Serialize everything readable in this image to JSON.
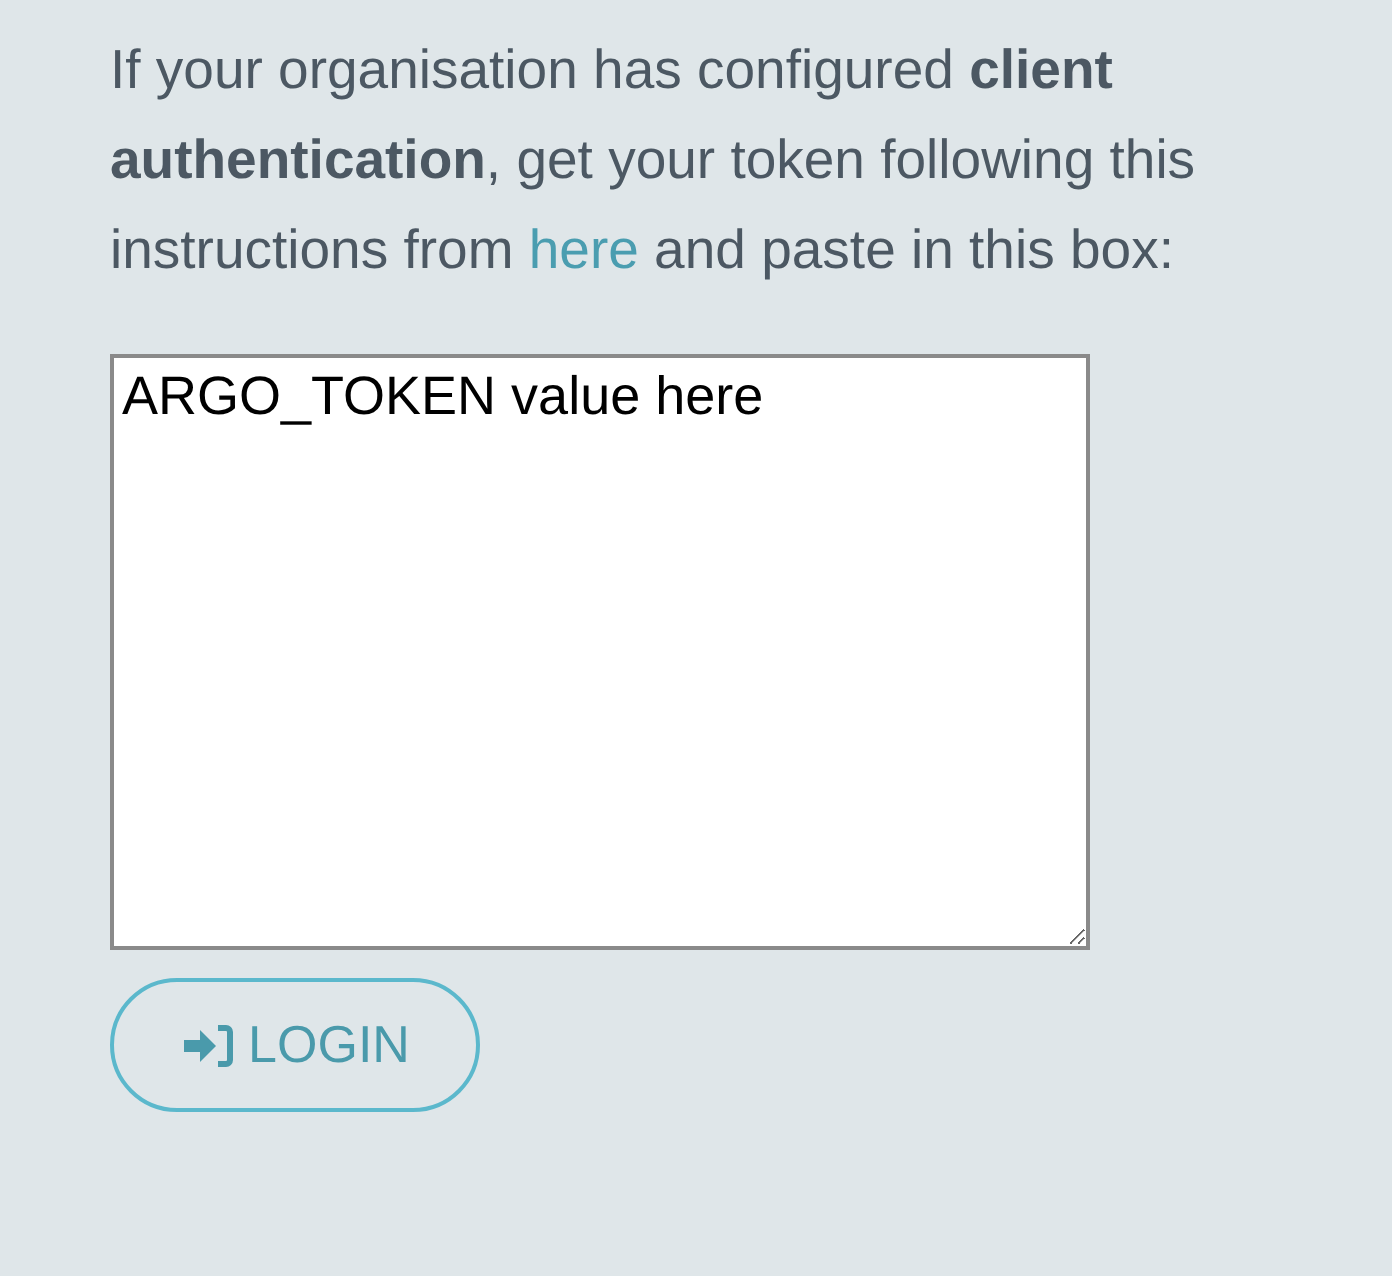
{
  "instructions": {
    "before_link": "If your organisation has configured **client authentication**, get your token following this instructions from ",
    "link": "here",
    "after_link": " and paste in this box:"
  },
  "token_field": {
    "value": "ARGO_TOKEN value here"
  },
  "login_button": {
    "label": "LOGIN"
  }
}
